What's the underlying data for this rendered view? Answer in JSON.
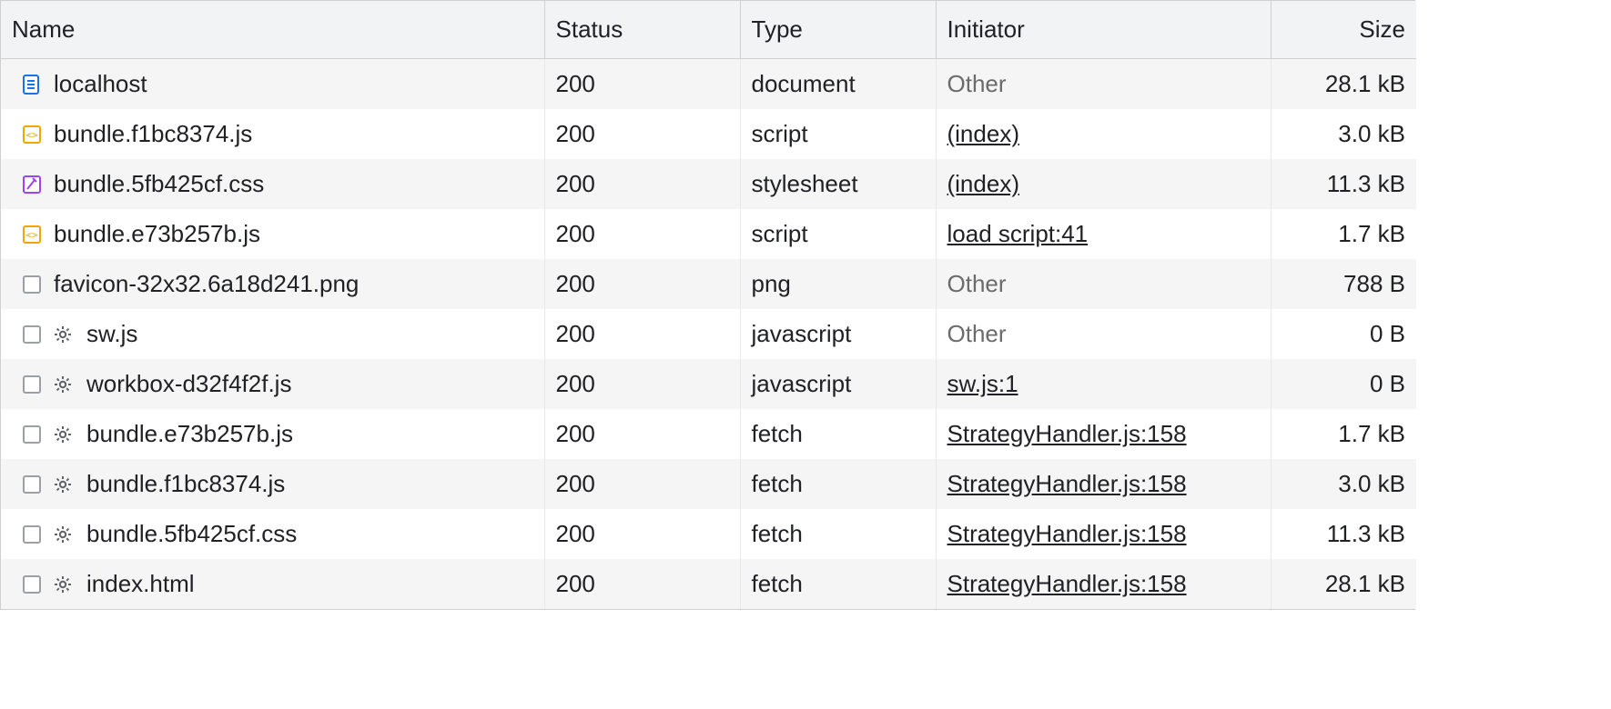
{
  "columns": {
    "name": "Name",
    "status": "Status",
    "type": "Type",
    "initiator": "Initiator",
    "size": "Size"
  },
  "rows": [
    {
      "icon": "document",
      "gear": false,
      "name": "localhost",
      "status": "200",
      "type": "document",
      "initiator": "Other",
      "initiator_link": false,
      "size": "28.1 kB"
    },
    {
      "icon": "js",
      "gear": false,
      "name": "bundle.f1bc8374.js",
      "status": "200",
      "type": "script",
      "initiator": "(index)",
      "initiator_link": true,
      "size": "3.0 kB"
    },
    {
      "icon": "css",
      "gear": false,
      "name": "bundle.5fb425cf.css",
      "status": "200",
      "type": "stylesheet",
      "initiator": "(index)",
      "initiator_link": true,
      "size": "11.3 kB"
    },
    {
      "icon": "js",
      "gear": false,
      "name": "bundle.e73b257b.js",
      "status": "200",
      "type": "script",
      "initiator": "load script:41",
      "initiator_link": true,
      "size": "1.7 kB"
    },
    {
      "icon": "generic",
      "gear": false,
      "name": "favicon-32x32.6a18d241.png",
      "status": "200",
      "type": "png",
      "initiator": "Other",
      "initiator_link": false,
      "size": "788 B"
    },
    {
      "icon": "generic",
      "gear": true,
      "name": "sw.js",
      "status": "200",
      "type": "javascript",
      "initiator": "Other",
      "initiator_link": false,
      "size": "0 B"
    },
    {
      "icon": "generic",
      "gear": true,
      "name": "workbox-d32f4f2f.js",
      "status": "200",
      "type": "javascript",
      "initiator": "sw.js:1",
      "initiator_link": true,
      "size": "0 B"
    },
    {
      "icon": "generic",
      "gear": true,
      "name": "bundle.e73b257b.js",
      "status": "200",
      "type": "fetch",
      "initiator": "StrategyHandler.js:158",
      "initiator_link": true,
      "size": "1.7 kB"
    },
    {
      "icon": "generic",
      "gear": true,
      "name": "bundle.f1bc8374.js",
      "status": "200",
      "type": "fetch",
      "initiator": "StrategyHandler.js:158",
      "initiator_link": true,
      "size": "3.0 kB"
    },
    {
      "icon": "generic",
      "gear": true,
      "name": "bundle.5fb425cf.css",
      "status": "200",
      "type": "fetch",
      "initiator": "StrategyHandler.js:158",
      "initiator_link": true,
      "size": "11.3 kB"
    },
    {
      "icon": "generic",
      "gear": true,
      "name": "index.html",
      "status": "200",
      "type": "fetch",
      "initiator": "StrategyHandler.js:158",
      "initiator_link": true,
      "size": "28.1 kB"
    }
  ]
}
